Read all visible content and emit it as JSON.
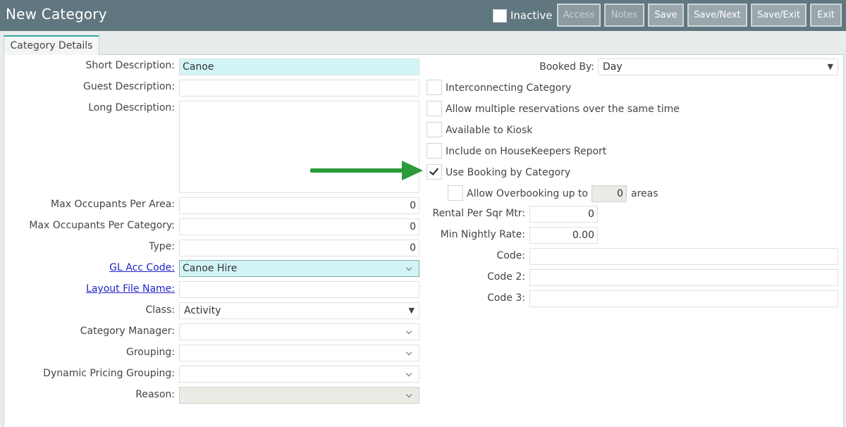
{
  "header": {
    "title": "New Category",
    "inactive_label": "Inactive",
    "buttons": {
      "access": "Access",
      "notes": "Notes",
      "save": "Save",
      "save_next": "Save/Next",
      "save_exit": "Save/Exit",
      "exit": "Exit"
    }
  },
  "tabs": {
    "category_details": "Category Details"
  },
  "left": {
    "short_description": {
      "label": "Short Description:",
      "value": "Canoe"
    },
    "guest_description": {
      "label": "Guest Description:",
      "value": ""
    },
    "long_description": {
      "label": "Long Description:",
      "value": ""
    },
    "max_occ_area": {
      "label": "Max Occupants Per Area:",
      "value": "0"
    },
    "max_occ_category": {
      "label": "Max Occupants Per Category:",
      "value": "0"
    },
    "type": {
      "label": "Type:",
      "value": "0"
    },
    "gl_acc_code": {
      "label": "GL Acc Code:",
      "value": "Canoe Hire"
    },
    "layout_file_name": {
      "label": "Layout File Name:",
      "value": ""
    },
    "class": {
      "label": "Class:",
      "value": "Activity"
    },
    "category_manager": {
      "label": "Category Manager:",
      "value": ""
    },
    "grouping": {
      "label": "Grouping:",
      "value": ""
    },
    "dynamic_pricing_grouping": {
      "label": "Dynamic Pricing Grouping:",
      "value": ""
    },
    "reason": {
      "label": "Reason:",
      "value": ""
    }
  },
  "right": {
    "booked_by": {
      "label": "Booked By:",
      "value": "Day"
    },
    "checks": {
      "interconnecting": "Interconnecting Category",
      "multiple_reservations": "Allow multiple reservations over the same time",
      "kiosk": "Available to Kiosk",
      "housekeepers": "Include on HouseKeepers Report",
      "booking_by_category": "Use Booking by Category"
    },
    "overbooking": {
      "label": "Allow Overbooking up to",
      "value": "0",
      "unit": "areas"
    },
    "rental_per_sqr_mtr": {
      "label": "Rental Per Sqr Mtr:",
      "value": "0"
    },
    "min_nightly_rate": {
      "label": "Min Nightly Rate:",
      "value": "0.00"
    },
    "code": {
      "label": "Code:",
      "value": ""
    },
    "code2": {
      "label": "Code 2:",
      "value": ""
    },
    "code3": {
      "label": "Code 3:",
      "value": ""
    }
  },
  "colors": {
    "header_bg": "#61777f",
    "highlight_field": "#d2f4f7",
    "arrow": "#2a9a3a",
    "link": "#2222cc"
  }
}
